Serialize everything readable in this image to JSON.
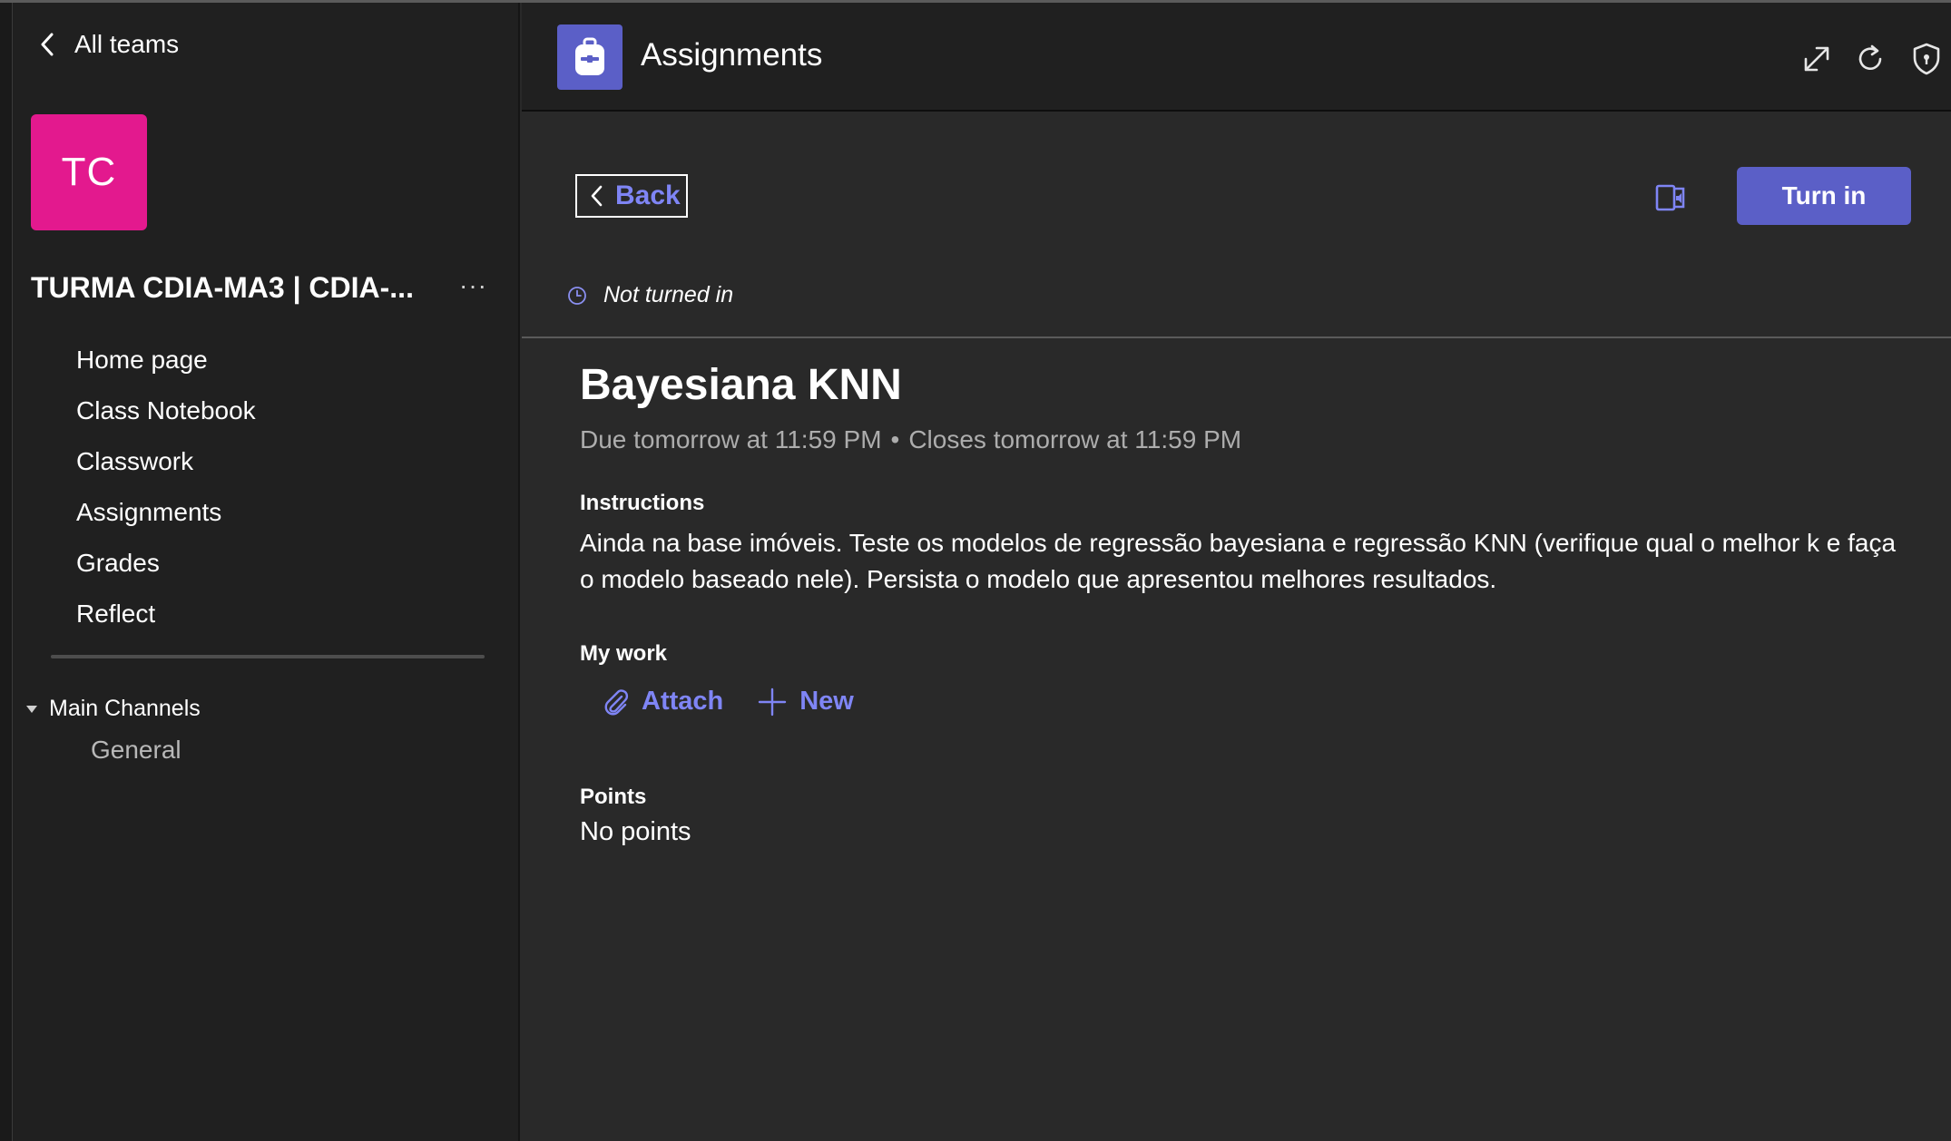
{
  "sidebar": {
    "all_teams_label": "All teams",
    "team_initials": "TC",
    "team_color": "#e3198e",
    "team_name": "TURMA CDIA-MA3 | CDIA-...",
    "more_label": "···",
    "nav": [
      {
        "label": "Home page"
      },
      {
        "label": "Class Notebook"
      },
      {
        "label": "Classwork"
      },
      {
        "label": "Assignments"
      },
      {
        "label": "Grades"
      },
      {
        "label": "Reflect"
      }
    ],
    "channels_header": "Main Channels",
    "channels": [
      {
        "label": "General"
      }
    ]
  },
  "header": {
    "app_title": "Assignments",
    "app_icon": "backpack-icon",
    "app_icon_color": "#5b5fc7",
    "actions": [
      "expand-icon",
      "refresh-icon",
      "shield-icon"
    ]
  },
  "main": {
    "back_label": "Back",
    "turn_in_label": "Turn in",
    "accent_color": "#5b5fc7",
    "link_color": "#7f85f5",
    "status": "Not turned in",
    "assignment_title": "Bayesiana KNN",
    "due": "Due tomorrow at 11:59 PM",
    "separator": "•",
    "closes": "Closes tomorrow at 11:59 PM",
    "instructions_label": "Instructions",
    "instructions_text": "Ainda na base imóveis. Teste os modelos de regressão bayesiana e regressão KNN (verifique qual o melhor k e faça o modelo baseado nele). Persista o modelo que apresentou melhores resultados.",
    "my_work_label": "My work",
    "attach_label": "Attach",
    "new_label": "New",
    "points_label": "Points",
    "points_value": "No points"
  }
}
